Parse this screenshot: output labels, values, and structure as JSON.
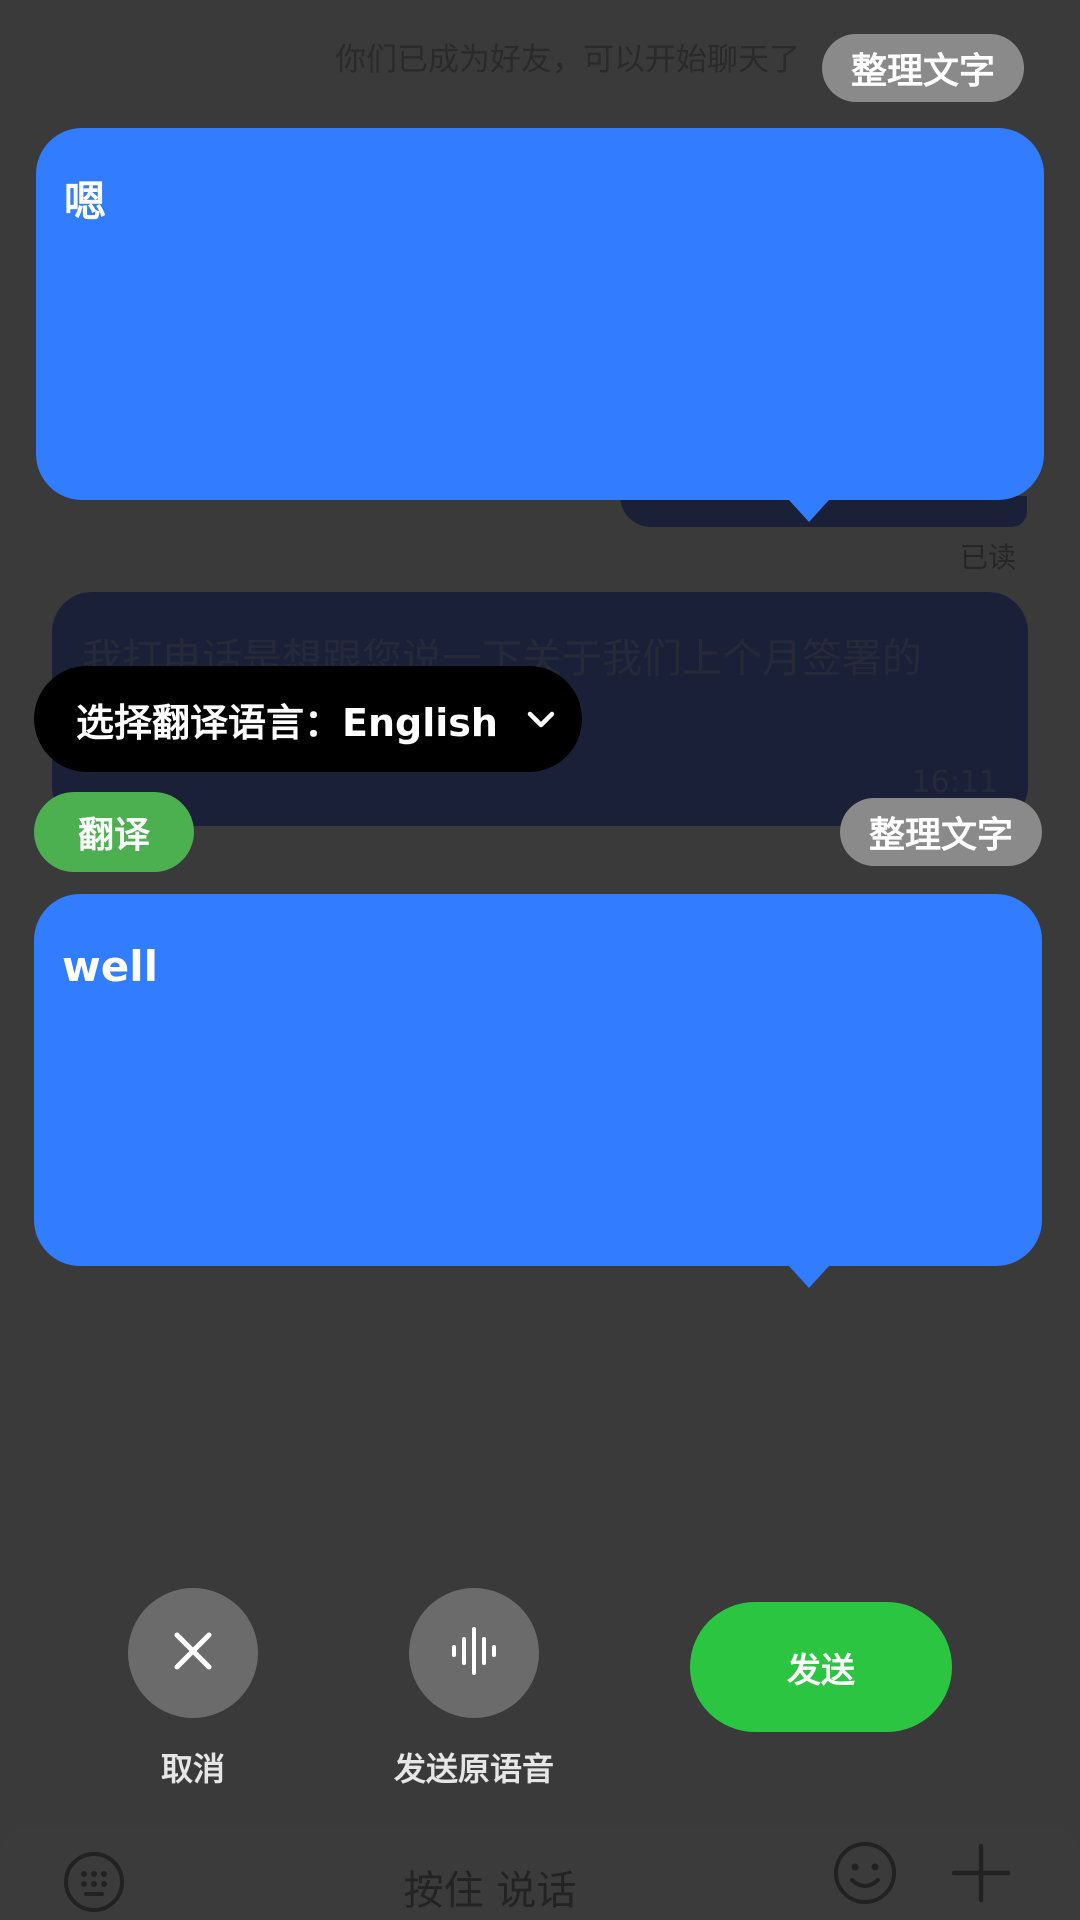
{
  "system_message": "你们已成为好友，可以开始聊天了",
  "chips": {
    "organize_text_top": "整理文字",
    "organize_text_bottom": "整理文字",
    "translate": "翻译"
  },
  "bubbles": {
    "original_text": "嗯",
    "translated_text": "well"
  },
  "chat": {
    "read_status": "已读",
    "background_message": "我打电话是想跟您说一下关于我们上个月签署的",
    "background_time": "16:11"
  },
  "language_selector": {
    "label": "选择翻译语言：English"
  },
  "actions": {
    "cancel_label": "取消",
    "send_original_voice_label": "发送原语音",
    "send_label": "发送"
  },
  "input_bar": {
    "hold_to_talk": "按住 说话"
  },
  "icons": {
    "cancel": "close-icon",
    "voice": "waveform-icon",
    "keyboard": "keyboard-icon",
    "emoji": "emoji-icon",
    "plus": "plus-icon",
    "chevron": "chevron-down-icon"
  },
  "colors": {
    "background": "#3a3a3a",
    "blue_bubble": "#317cff",
    "send_green": "#2cc542",
    "translate_green": "#4caf50"
  }
}
